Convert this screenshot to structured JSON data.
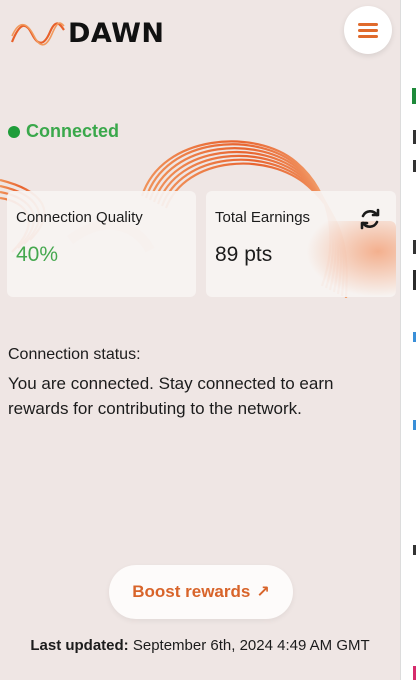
{
  "app": {
    "logo_text": "DAWN",
    "colors": {
      "accent": "#e06a2c",
      "connected": "#3aa84b",
      "background": "#efe6e4"
    }
  },
  "header": {
    "menu_icon": "hamburger-icon"
  },
  "status": {
    "label": "Connected"
  },
  "cards": {
    "quality": {
      "label": "Connection Quality",
      "value": "40%"
    },
    "earnings": {
      "label": "Total Earnings",
      "value": "89 pts",
      "icon": "refresh-icon"
    }
  },
  "connection": {
    "heading": "Connection status:",
    "description": "You are connected. Stay connected to earn rewards for contributing to the network."
  },
  "boost": {
    "label": "Boost rewards",
    "arrow": "↗"
  },
  "updated": {
    "label": "Last updated:",
    "value": "September 6th, 2024 4:49 AM GMT"
  }
}
